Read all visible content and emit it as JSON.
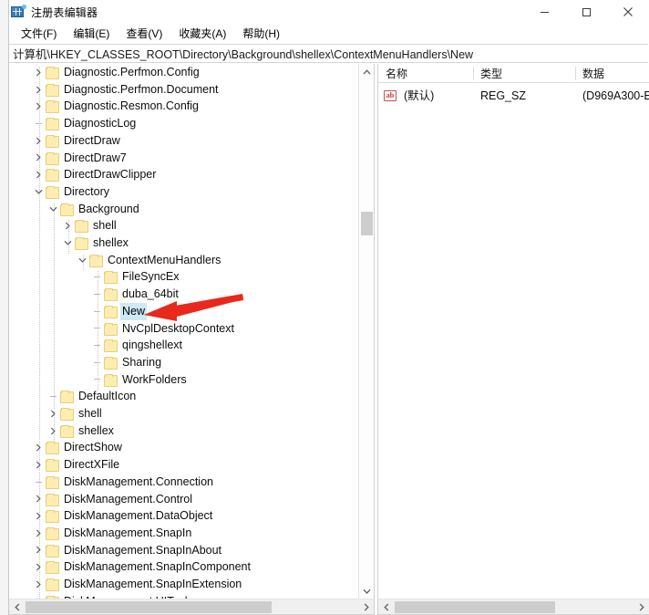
{
  "window": {
    "title": "注册表编辑器",
    "icon": "registry-editor-icon",
    "minimize_label": "最小化",
    "maximize_label": "最大化",
    "close_label": "关闭"
  },
  "menubar": {
    "items": [
      {
        "label": "文件(F)",
        "text": "文件(",
        "accel": "F",
        "tail": ")"
      },
      {
        "label": "编辑(E)",
        "text": "编辑(",
        "accel": "E",
        "tail": ")"
      },
      {
        "label": "查看(V)",
        "text": "查看(",
        "accel": "V",
        "tail": ")"
      },
      {
        "label": "收藏夹(A)",
        "text": "收藏夹(",
        "accel": "A",
        "tail": ")"
      },
      {
        "label": "帮助(H)",
        "text": "帮助(",
        "accel": "H",
        "tail": ")"
      }
    ]
  },
  "address": {
    "path": "计算机\\HKEY_CLASSES_ROOT\\Directory\\Background\\shellex\\ContextMenuHandlers\\New"
  },
  "tree": {
    "selected_key": "New",
    "selection_color": "#cde8f7",
    "annotation_arrow_color": "#e8291c",
    "nodes": [
      {
        "label": "Diagnostic.Perfmon.Config",
        "depth": 1,
        "expander": "collapsed"
      },
      {
        "label": "Diagnostic.Perfmon.Document",
        "depth": 1,
        "expander": "collapsed"
      },
      {
        "label": "Diagnostic.Resmon.Config",
        "depth": 1,
        "expander": "collapsed"
      },
      {
        "label": "DiagnosticLog",
        "depth": 1,
        "expander": "leaf"
      },
      {
        "label": "DirectDraw",
        "depth": 1,
        "expander": "collapsed"
      },
      {
        "label": "DirectDraw7",
        "depth": 1,
        "expander": "collapsed"
      },
      {
        "label": "DirectDrawClipper",
        "depth": 1,
        "expander": "collapsed"
      },
      {
        "label": "Directory",
        "depth": 1,
        "expander": "expanded"
      },
      {
        "label": "Background",
        "depth": 2,
        "expander": "expanded"
      },
      {
        "label": "shell",
        "depth": 3,
        "expander": "collapsed"
      },
      {
        "label": "shellex",
        "depth": 3,
        "expander": "expanded"
      },
      {
        "label": "ContextMenuHandlers",
        "depth": 4,
        "expander": "expanded"
      },
      {
        "label": "FileSyncEx",
        "depth": 5,
        "expander": "leaf"
      },
      {
        "label": "duba_64bit",
        "depth": 5,
        "expander": "leaf"
      },
      {
        "label": "New",
        "depth": 5,
        "expander": "leaf",
        "selected": true
      },
      {
        "label": "NvCplDesktopContext",
        "depth": 5,
        "expander": "leaf"
      },
      {
        "label": "qingshellext",
        "depth": 5,
        "expander": "leaf"
      },
      {
        "label": "Sharing",
        "depth": 5,
        "expander": "leaf"
      },
      {
        "label": "WorkFolders",
        "depth": 5,
        "expander": "leaf"
      },
      {
        "label": "DefaultIcon",
        "depth": 2,
        "expander": "leaf"
      },
      {
        "label": "shell",
        "depth": 2,
        "expander": "collapsed"
      },
      {
        "label": "shellex",
        "depth": 2,
        "expander": "collapsed"
      },
      {
        "label": "DirectShow",
        "depth": 1,
        "expander": "collapsed"
      },
      {
        "label": "DirectXFile",
        "depth": 1,
        "expander": "collapsed"
      },
      {
        "label": "DiskManagement.Connection",
        "depth": 1,
        "expander": "leaf"
      },
      {
        "label": "DiskManagement.Control",
        "depth": 1,
        "expander": "collapsed"
      },
      {
        "label": "DiskManagement.DataObject",
        "depth": 1,
        "expander": "collapsed"
      },
      {
        "label": "DiskManagement.SnapIn",
        "depth": 1,
        "expander": "collapsed"
      },
      {
        "label": "DiskManagement.SnapInAbout",
        "depth": 1,
        "expander": "collapsed"
      },
      {
        "label": "DiskManagement.SnapInComponent",
        "depth": 1,
        "expander": "collapsed"
      },
      {
        "label": "DiskManagement.SnapInExtension",
        "depth": 1,
        "expander": "collapsed"
      },
      {
        "label": "DiskManagement.UITasks",
        "depth": 1,
        "expander": "collapsed"
      }
    ]
  },
  "values_pane": {
    "columns": [
      {
        "key": "name",
        "label": "名称"
      },
      {
        "key": "type",
        "label": "类型"
      },
      {
        "key": "data",
        "label": "数据"
      }
    ],
    "rows": [
      {
        "icon": "string-value-icon",
        "name": "(默认)",
        "type": "REG_SZ",
        "data": "(D969A300-E"
      }
    ]
  },
  "scrollbars": {
    "tree_vertical": {
      "up": "▲",
      "down": "▼"
    },
    "tree_horizontal": {
      "left": "◀",
      "right": "▶"
    },
    "values_horizontal": {
      "left": "◀",
      "right": "▶"
    }
  }
}
